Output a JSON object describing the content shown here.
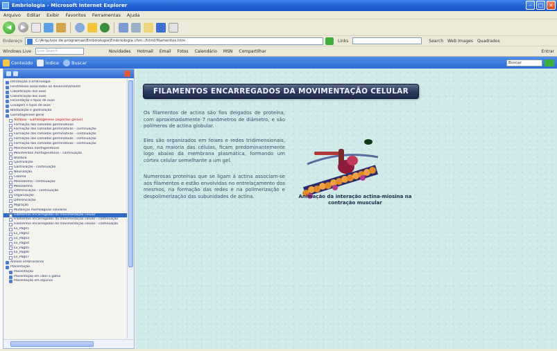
{
  "window": {
    "title": "Embriologia - Microsoft Internet Explorer"
  },
  "menubar": [
    "Arquivo",
    "Editar",
    "Exibir",
    "Favoritos",
    "Ferramentas",
    "Ajuda"
  ],
  "address": {
    "label": "Endereço",
    "url": "C:\\Arquivos de programas\\Embriologia\\Embriologia.chm::/html/filamentos.htm",
    "go": "Ir",
    "links": [
      "Links",
      "Search",
      "Web Images",
      "Quadrados"
    ]
  },
  "linksbar": {
    "tag": "Windows Live",
    "field_placeholder": "Live Search",
    "items": [
      "Novidades",
      "Hotmail",
      "Email",
      "Fotos",
      "Calendário",
      "MSN",
      "Compartilhar"
    ],
    "right": [
      "Entrar"
    ]
  },
  "helpbar": {
    "items": [
      "Conteúdo",
      "Índice",
      "Buscar"
    ],
    "search_label": "Buscar"
  },
  "sidebar": {
    "tree": [
      {
        "label": "Introdução à embriologia",
        "level": 0,
        "type": "book"
      },
      {
        "label": "Fenômenos associados ao desenvolvimento",
        "level": 0,
        "type": "book"
      },
      {
        "label": "Classificação dos ovos",
        "level": 0,
        "type": "book"
      },
      {
        "label": "Classificação dos ovos",
        "level": 0,
        "type": "book"
      },
      {
        "label": "Fecundação e tipos de ovos",
        "level": 0,
        "type": "book"
      },
      {
        "label": "Clivagem e tipos de ovos",
        "level": 0,
        "type": "book"
      },
      {
        "label": "Blastulação e gastrulação",
        "level": 0,
        "type": "book"
      },
      {
        "label": "Gametogênese geral",
        "level": 0,
        "type": "book"
      },
      {
        "label": "Anfíbios - Gametogênese (aspectos gerais)",
        "level": 1,
        "type": "page",
        "red": true
      },
      {
        "label": "Formação das camadas germinativas",
        "level": 1,
        "type": "page"
      },
      {
        "label": "Formação das camadas germinativas - continuação",
        "level": 1,
        "type": "page"
      },
      {
        "label": "Formação das camadas germinativas - continuação",
        "level": 1,
        "type": "page"
      },
      {
        "label": "Formação das camadas germinativas - continuação",
        "level": 1,
        "type": "page"
      },
      {
        "label": "Formação das camadas germinativas - continuação",
        "level": 1,
        "type": "page"
      },
      {
        "label": "Movimentos morfogenéticos",
        "level": 1,
        "type": "page"
      },
      {
        "label": "Movimentos morfogenéticos - continuação",
        "level": 1,
        "type": "page"
      },
      {
        "label": "Blástula",
        "level": 1,
        "type": "page"
      },
      {
        "label": "Gastrulação",
        "level": 1,
        "type": "page"
      },
      {
        "label": "Gastrulação - continuação",
        "level": 1,
        "type": "page"
      },
      {
        "label": "Neurulação",
        "level": 1,
        "type": "page"
      },
      {
        "label": "Celoma",
        "level": 1,
        "type": "page"
      },
      {
        "label": "Mesoderma - continuação",
        "level": 1,
        "type": "page"
      },
      {
        "label": "Mesoderma",
        "level": 1,
        "type": "page"
      },
      {
        "label": "Diferenciação - continuação",
        "level": 1,
        "type": "page"
      },
      {
        "label": "Organização",
        "level": 1,
        "type": "page"
      },
      {
        "label": "Diferenciação",
        "level": 1,
        "type": "page"
      },
      {
        "label": "Migração",
        "level": 1,
        "type": "page"
      },
      {
        "label": "Mudanças morfológicas celulares",
        "level": 1,
        "type": "page"
      },
      {
        "label": "Filamentos encarregados da movimentação celular",
        "level": 1,
        "type": "page",
        "selected": true
      },
      {
        "label": "Filamentos encarregados da movimentação celular - continuação",
        "level": 1,
        "type": "page"
      },
      {
        "label": "Filamentos encarregados da movimentação celular - continuação",
        "level": 1,
        "type": "page"
      },
      {
        "label": "Ex_Pag01",
        "level": 1,
        "type": "page"
      },
      {
        "label": "Ex_Pag02",
        "level": 1,
        "type": "page"
      },
      {
        "label": "Ex_Pag03",
        "level": 1,
        "type": "page"
      },
      {
        "label": "Ex_Pag04",
        "level": 1,
        "type": "page"
      },
      {
        "label": "Ex_Pag05",
        "level": 1,
        "type": "page"
      },
      {
        "label": "Ex_Pag06",
        "level": 1,
        "type": "page"
      },
      {
        "label": "Ex_Pag07",
        "level": 1,
        "type": "page"
      },
      {
        "label": "Anexos embrionários",
        "level": 0,
        "type": "book"
      },
      {
        "label": "Placentação",
        "level": 0,
        "type": "book"
      },
      {
        "label": "Placentação",
        "level": 1,
        "type": "book"
      },
      {
        "label": "Placentação em cães e gatos",
        "level": 1,
        "type": "book"
      },
      {
        "label": "Placentação em equinos",
        "level": 1,
        "type": "book"
      }
    ]
  },
  "content": {
    "heading": "FILAMENTOS ENCARREGADOS DA MOVIMENTAÇÃO CELULAR",
    "paragraphs": [
      "Os filamentos de actina são fios delgados de proteína, com aproximadamente 7 nanômetros de diâmetro, e são polímeros de actina globular.",
      "Eles são organizados em feixes e redes tridimensionais, que, na maioria das células, ficam predominantemente logo abaixo da membrana plasmática, formando um córtex celular semelhante a um gel.",
      "Numerosas proteínas que se ligam à actina associam-se aos filamentos e estão envolvidas no entrelaçamento dos mesmos, na formação das redes e na polimerização e despolimerização das subunidades de actina."
    ],
    "figure_caption": "Animação da interação actina-miosina na contração muscular"
  },
  "colors": {
    "content_bg": "#cfe9e8",
    "banner": "#2d3a60",
    "text": "#3a4d6a",
    "selected": "#316ac5"
  }
}
